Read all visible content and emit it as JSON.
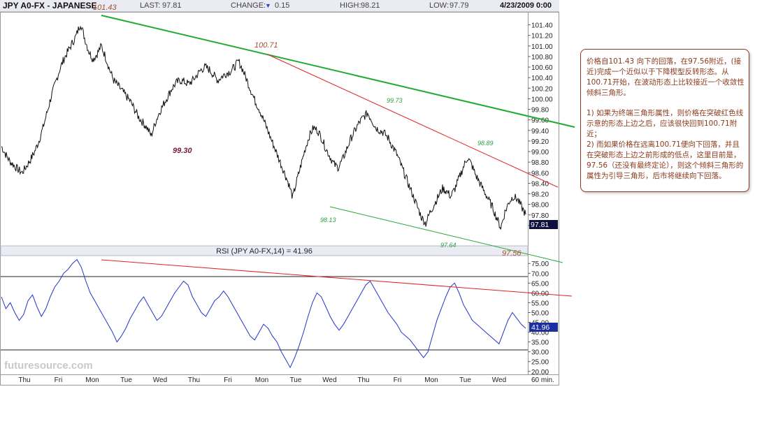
{
  "header": {
    "symbol": "JPY A0-FX - JAPANESE",
    "last_label": "LAST:",
    "last": "97.81",
    "change_label": "CHANGE:",
    "change_icon": "down-triangle",
    "change": "0.15",
    "high_label": "HIGH:",
    "high": "98.21",
    "low_label": "LOW:",
    "low": "97.79",
    "date": "4/23/2009 0:00"
  },
  "colors": {
    "price": "#111111",
    "rsi": "#2233cc",
    "green_line": "#22aa33",
    "red_line": "#dd2222",
    "annotation_brown": "#a0522d",
    "annotation_green": "#2ea043",
    "annotation_purple": "#7a1a3a",
    "header_bg": "#ebebf3"
  },
  "watermark": "futuresource.com",
  "time_axis": {
    "labels": [
      "Thu",
      "Fri",
      "Mon",
      "Tue",
      "Wed",
      "Thu",
      "Fri",
      "Mon",
      "Tue",
      "Wed",
      "Thu",
      "Fri",
      "Mon",
      "Tue",
      "Wed",
      "60 min."
    ]
  },
  "chart_data": [
    {
      "type": "line",
      "name": "price",
      "interval": "60 min.",
      "ylim": [
        97.4,
        101.5
      ],
      "yticks": [
        "101.40",
        "101.20",
        "101.00",
        "100.80",
        "100.60",
        "100.40",
        "100.20",
        "100.00",
        "99.80",
        "99.60",
        "99.40",
        "99.20",
        "99.00",
        "98.80",
        "98.60",
        "98.40",
        "98.20",
        "98.00",
        "97.80",
        "97.60"
      ],
      "last_value": "97.81",
      "x": [
        0,
        2,
        4,
        6,
        8,
        10,
        12,
        14,
        16,
        18,
        20,
        22,
        24,
        26,
        28,
        30,
        32,
        34,
        36,
        38,
        40,
        42,
        44,
        46,
        48,
        50,
        52,
        54,
        56,
        58,
        60,
        62,
        64,
        66,
        68,
        70,
        72,
        74,
        76,
        78,
        80,
        82,
        84,
        86,
        88,
        90,
        92,
        94,
        96,
        98,
        100,
        102,
        104,
        106,
        108,
        110,
        112,
        114,
        116,
        118,
        120,
        122,
        124,
        126,
        128,
        130,
        132,
        134,
        136,
        138,
        140,
        142,
        144,
        146,
        148,
        150,
        152,
        154,
        156,
        158,
        160,
        162,
        164,
        166,
        168,
        170,
        172,
        174,
        176,
        178,
        180,
        182,
        184,
        186,
        188,
        190,
        192,
        194,
        196,
        198,
        200,
        202,
        204,
        206,
        208,
        210,
        212,
        214,
        216,
        218,
        220,
        222,
        224,
        226,
        228,
        230,
        232,
        234,
        236,
        238,
        240,
        242,
        244,
        246,
        248,
        250,
        252,
        254,
        256,
        258,
        260,
        262,
        264,
        266,
        268,
        270,
        272,
        274,
        276,
        278,
        280,
        282,
        284,
        286,
        288,
        290,
        292,
        294,
        296,
        298,
        300,
        302,
        304,
        306,
        308,
        310,
        312,
        314,
        316,
        318,
        320,
        322,
        324,
        326,
        328,
        330,
        332,
        334,
        336,
        338,
        340,
        342,
        344,
        346,
        348,
        350,
        352,
        354,
        356,
        358,
        360,
        362,
        364,
        366,
        368,
        370,
        372,
        374,
        376
      ],
      "values": [
        99.1,
        98.95,
        98.82,
        98.74,
        98.66,
        98.6,
        98.72,
        98.85,
        99.0,
        99.2,
        99.45,
        99.75,
        100.05,
        100.3,
        100.55,
        100.75,
        100.9,
        101.05,
        101.2,
        101.43,
        101.15,
        100.9,
        100.75,
        100.85,
        101.0,
        100.8,
        100.55,
        100.35,
        100.25,
        100.15,
        100.05,
        99.95,
        99.8,
        99.65,
        99.55,
        99.45,
        99.3,
        99.55,
        99.75,
        99.9,
        100.05,
        100.2,
        100.3,
        100.35,
        100.32,
        100.28,
        100.35,
        100.45,
        100.55,
        100.6,
        100.55,
        100.45,
        100.35,
        100.42,
        100.48,
        100.52,
        100.6,
        100.71,
        100.55,
        100.35,
        100.15,
        99.95,
        99.8,
        99.6,
        99.4,
        99.2,
        99.0,
        98.8,
        98.6,
        98.4,
        98.13,
        98.45,
        98.75,
        99.05,
        99.3,
        99.45,
        99.4,
        99.25,
        99.05,
        98.9,
        98.75,
        98.7,
        98.85,
        99.05,
        99.25,
        99.4,
        99.55,
        99.65,
        99.73,
        99.6,
        99.45,
        99.4,
        99.35,
        99.25,
        99.1,
        98.95,
        98.75,
        98.55,
        98.35,
        98.15,
        97.95,
        97.75,
        97.64,
        97.85,
        98.0,
        98.15,
        98.3,
        98.25,
        98.15,
        98.3,
        98.5,
        98.7,
        98.89,
        98.75,
        98.55,
        98.4,
        98.25,
        98.1,
        97.95,
        97.75,
        97.56,
        97.85,
        98.05,
        98.15,
        98.1,
        97.95,
        97.81
      ]
    },
    {
      "type": "line",
      "name": "RSI",
      "title": "RSI (JPY A0-FX,14) = 41.96",
      "ylim": [
        18.5,
        79
      ],
      "yticks": [
        "75.00",
        "70.00",
        "65.00",
        "60.00",
        "55.00",
        "50.00",
        "45.00",
        "40.00",
        "35.00",
        "30.00",
        "25.00",
        "20.00"
      ],
      "reference_lines": [
        70,
        30
      ],
      "last_value": "41.96",
      "values": [
        58,
        52,
        55,
        50,
        46,
        49,
        56,
        59,
        53,
        48,
        52,
        58,
        63,
        66,
        70,
        72,
        75,
        77,
        73,
        66,
        60,
        56,
        52,
        48,
        44,
        40,
        35,
        38,
        42,
        47,
        51,
        55,
        58,
        54,
        50,
        46,
        48,
        52,
        56,
        60,
        63,
        66,
        64,
        58,
        54,
        50,
        48,
        52,
        56,
        58,
        61,
        58,
        54,
        50,
        46,
        42,
        38,
        36,
        40,
        44,
        42,
        38,
        35,
        30,
        26,
        22,
        27,
        33,
        40,
        48,
        55,
        60,
        58,
        53,
        48,
        44,
        41,
        44,
        48,
        52,
        56,
        60,
        64,
        66,
        62,
        58,
        54,
        50,
        47,
        44,
        40,
        38,
        36,
        33,
        30,
        27,
        30,
        38,
        46,
        52,
        58,
        63,
        65,
        60,
        54,
        50,
        46,
        44,
        42,
        40,
        38,
        36,
        34,
        40,
        46,
        50,
        47,
        44,
        41.96
      ]
    }
  ],
  "annotations": {
    "top_left": "101.43",
    "top_mid": "100.71",
    "left_low": "99.30",
    "mid_low": "98.13",
    "peak_mid": "99.73",
    "low_right": "97.64",
    "peak_right": "98.89",
    "low_far_right": "97.56"
  },
  "note": {
    "paragraph1": "价格自101.43 向下的回落，在97.56附近，(接近)完成一个近似以于下降楔型反转形态。从100.71开始，在波动形态上比较接近一个收敛性倾斜三角形。",
    "paragraph2": "1) 如果为终端三角形属性，则价格在突破红色线示意的形态上边之后，应该很快回到100.71附近；",
    "paragraph3": "2) 而如果价格在远离100.71便向下回落，并且在突破形态上边之前形成的低点，这里目前是，97.56（还没有最终定论），则这个倾斜三角形的属性为引导三角形，后市将继续向下回落。"
  }
}
